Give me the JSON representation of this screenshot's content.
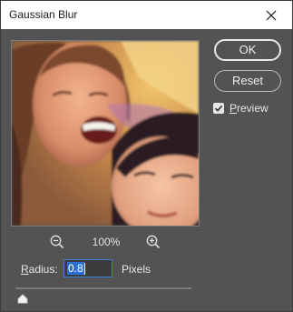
{
  "window": {
    "title": "Gaussian Blur",
    "close_icon": "close-icon"
  },
  "preview": {
    "zoom_level": "100%",
    "zoom_out_icon": "zoom-out-icon",
    "zoom_in_icon": "zoom-in-icon"
  },
  "buttons": {
    "ok_label": "OK",
    "reset_label": "Reset"
  },
  "preview_checkbox": {
    "label_first": "P",
    "label_rest": "review",
    "checked": true
  },
  "radius": {
    "label_first": "R",
    "label_rest": "adius:",
    "value": "0.8",
    "units": "Pixels",
    "slider_value": 0.8
  },
  "colors": {
    "dialog_bg": "#535353",
    "titlebar_bg": "#ffffff",
    "accent_selection": "#2a6fd1"
  }
}
